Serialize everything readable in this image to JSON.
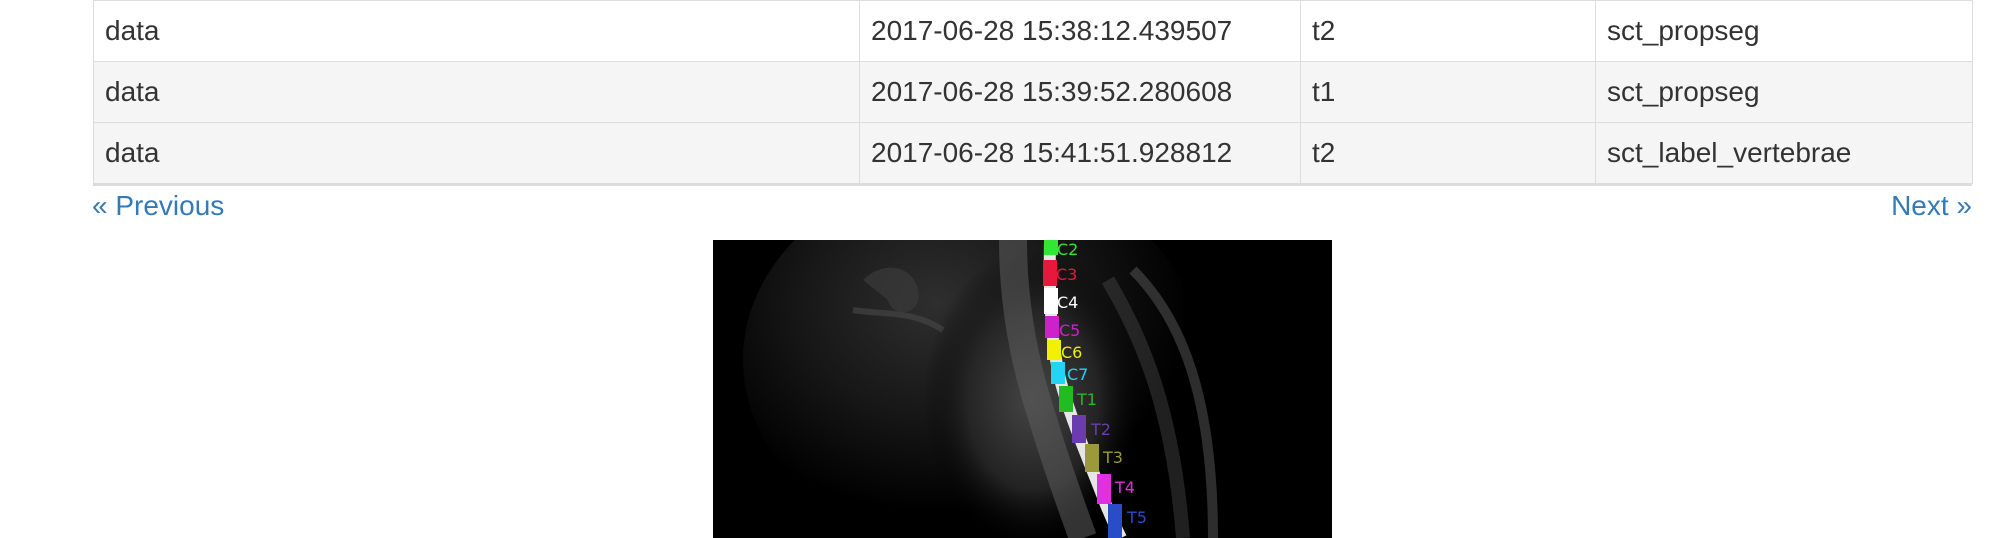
{
  "table": {
    "rows": [
      {
        "folder": "data",
        "date": "2017-06-28 15:38:12.439507",
        "contrast": "t2",
        "command": "sct_propseg"
      },
      {
        "folder": "data",
        "date": "2017-06-28 15:39:52.280608",
        "contrast": "t1",
        "command": "sct_propseg"
      },
      {
        "folder": "data",
        "date": "2017-06-28 15:41:51.928812",
        "contrast": "t2",
        "command": "sct_label_vertebrae"
      }
    ]
  },
  "pager": {
    "previous_label": "« Previous",
    "next_label": "Next »"
  },
  "viewer": {
    "labels": [
      {
        "text": "C2",
        "color": "#33e633"
      },
      {
        "text": "C3",
        "color": "#e6193c"
      },
      {
        "text": "C4",
        "color": "#ffffff"
      },
      {
        "text": "C5",
        "color": "#cc22cc"
      },
      {
        "text": "C6",
        "color": "#f0f000"
      },
      {
        "text": "C7",
        "color": "#22d5f5"
      },
      {
        "text": "T1",
        "color": "#22bb22"
      },
      {
        "text": "T2",
        "color": "#6a3cb0"
      },
      {
        "text": "T3",
        "color": "#9a9a3a"
      },
      {
        "text": "T4",
        "color": "#e030e0"
      },
      {
        "text": "T5",
        "color": "#2a4cc8"
      }
    ]
  },
  "colors": {
    "link": "#337ab7",
    "border": "#dddddd",
    "stripe": "#f5f5f5"
  }
}
